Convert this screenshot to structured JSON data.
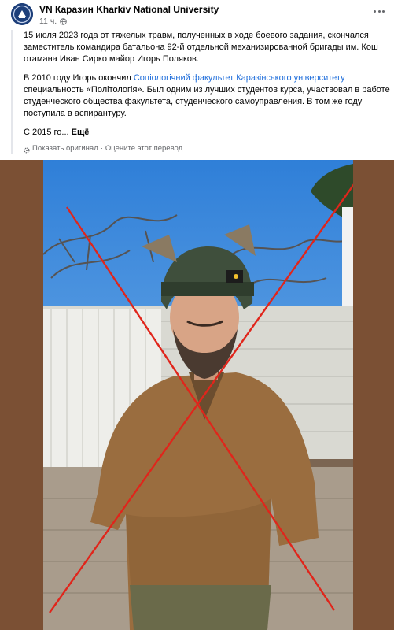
{
  "post": {
    "author": "VN Каразин Kharkiv National University",
    "time": "11 ч.",
    "paragraph1": "15 июля 2023 года от тяжелых травм, полученных в ходе боевого задания, скончался заместитель командира батальона 92-й отдельной механизированной бригады им. Кош отамана Иван Сирко майор Игорь Поляков.",
    "paragraph2_before": "В 2010 году Игорь окончил ",
    "paragraph2_link": "Соціологічний факультет Каразінського університету",
    "paragraph2_after": " специальность «Політологія». Был одним из лучших студентов курса, участвовал в работе студенческого общества факультета, студенческого самоуправления. В том же году поступила в аспирантуру.",
    "paragraph3": "С 2015 го...",
    "more_label": "Ещё",
    "translate_original": "Показать оригинал",
    "translate_rate": "Оцените этот перевод",
    "translate_separator": "·"
  },
  "icons": {
    "avatar": "university-logo-icon",
    "globe": "globe-icon",
    "more": "more-options-icon",
    "translate": "translate-gear-icon"
  },
  "colors": {
    "link": "#216fdb",
    "meta": "#65676b",
    "photo_border": "#7b5034",
    "cross": "#e0251b"
  }
}
